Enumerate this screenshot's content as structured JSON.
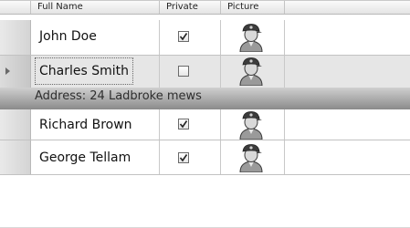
{
  "grid": {
    "columns": [
      {
        "label": "Full Name"
      },
      {
        "label": "Private"
      },
      {
        "label": "Picture"
      }
    ],
    "rows": [
      {
        "name": "John Doe",
        "private": true,
        "picture_icon": "person-avatar-icon"
      },
      {
        "name": "Charles Smith",
        "private": false,
        "picture_icon": "person-avatar-icon",
        "selected": true,
        "detail": "Address: 24 Ladbroke mews"
      },
      {
        "name": "Richard Brown",
        "private": true,
        "picture_icon": "person-avatar-icon"
      },
      {
        "name": "George Tellam",
        "private": true,
        "picture_icon": "person-avatar-icon"
      }
    ]
  }
}
